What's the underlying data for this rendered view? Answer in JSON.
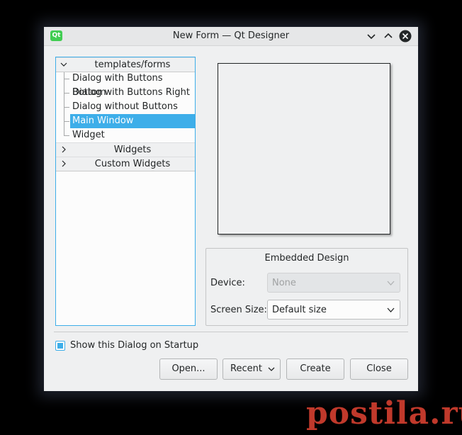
{
  "window": {
    "title": "New Form — Qt Designer",
    "app_icon_text": "Qt"
  },
  "templates_tree": {
    "category_open": "templates/forms",
    "items": [
      "Dialog with Buttons Bottom",
      "Dialog with Buttons Right",
      "Dialog without Buttons",
      "Main Window",
      "Widget"
    ],
    "selected_item": "Main Window",
    "category_widgets": "Widgets",
    "category_custom": "Custom Widgets"
  },
  "embedded_design": {
    "title": "Embedded Design",
    "device_label": "Device:",
    "device_value": "None",
    "screen_size_label": "Screen Size:",
    "screen_size_value": "Default size"
  },
  "startup_checkbox": {
    "label": "Show this Dialog on Startup",
    "checked": true
  },
  "buttons": {
    "open": "Open...",
    "recent": "Recent",
    "create": "Create",
    "close": "Close"
  },
  "watermark": "postila.ru",
  "colors": {
    "accent": "#3daee9",
    "window_bg": "#eff0f1",
    "watermark": "#c0392b"
  }
}
